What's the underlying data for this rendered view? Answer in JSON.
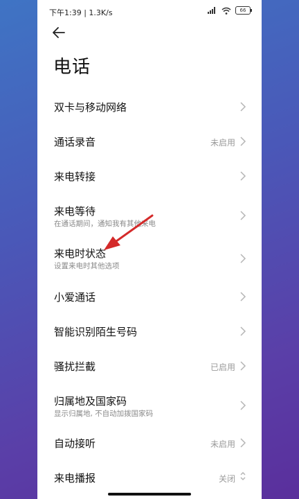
{
  "status_bar": {
    "time_speed": "下午1:39 | 1.3K/s",
    "battery": "66"
  },
  "header": {
    "title": "电话"
  },
  "settings": [
    {
      "title": "双卡与移动网络",
      "subtitle": "",
      "value": ""
    },
    {
      "title": "通话录音",
      "subtitle": "",
      "value": "未启用"
    },
    {
      "title": "来电转接",
      "subtitle": "",
      "value": ""
    },
    {
      "title": "来电等待",
      "subtitle": "在通话期间，通知我有其他来电",
      "value": ""
    },
    {
      "title": "来电时状态",
      "subtitle": "设置来电时其他选项",
      "value": ""
    },
    {
      "title": "小爱通话",
      "subtitle": "",
      "value": ""
    },
    {
      "title": "智能识别陌生号码",
      "subtitle": "",
      "value": ""
    },
    {
      "title": "骚扰拦截",
      "subtitle": "",
      "value": "已启用"
    },
    {
      "title": "归属地及国家码",
      "subtitle": "显示归属地, 不自动加拨国家码",
      "value": ""
    },
    {
      "title": "自动接听",
      "subtitle": "",
      "value": "未启用"
    },
    {
      "title": "来电播报",
      "subtitle": "",
      "value": "关闭"
    }
  ],
  "colors": {
    "annotation_arrow": "#d42a2a",
    "background_start": "#3f74c4",
    "background_end": "#5a2f9c"
  }
}
